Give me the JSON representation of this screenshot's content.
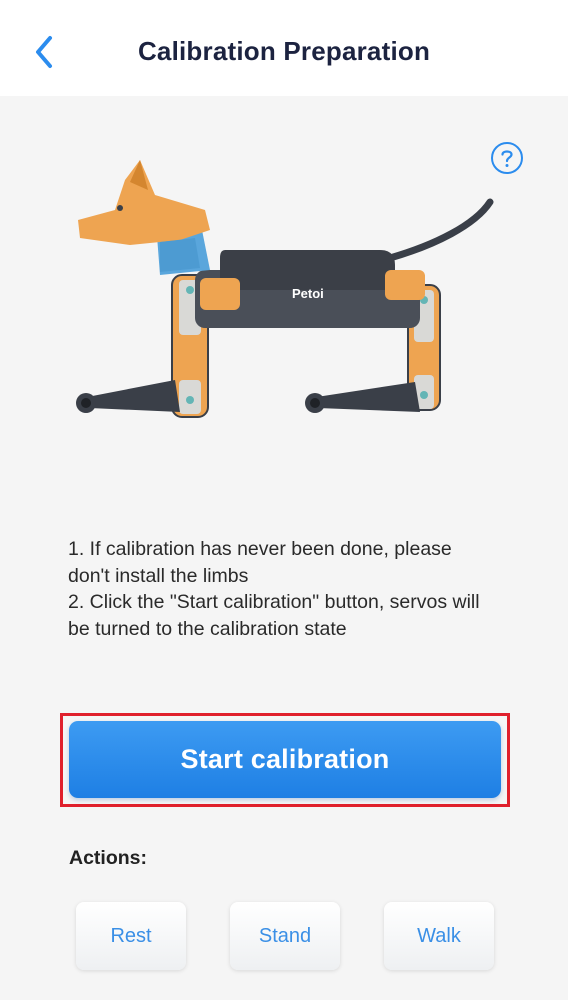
{
  "header": {
    "title": "Calibration Preparation",
    "back_icon": "chevron-left-icon"
  },
  "help": {
    "icon": "question-circle-icon"
  },
  "illustration": {
    "brand_text": "Petoi"
  },
  "instructions": {
    "line1": "1. If calibration has never been done, please don't install the limbs",
    "line2": "2. Click the \"Start calibration\" button, servos will be turned to the calibration state"
  },
  "start_button": {
    "label": "Start calibration"
  },
  "actions": {
    "label": "Actions:",
    "rest": "Rest",
    "stand": "Stand",
    "walk": "Walk"
  },
  "colors": {
    "accent": "#2b8cee",
    "title": "#1c2340",
    "highlight": "#e0202c"
  }
}
